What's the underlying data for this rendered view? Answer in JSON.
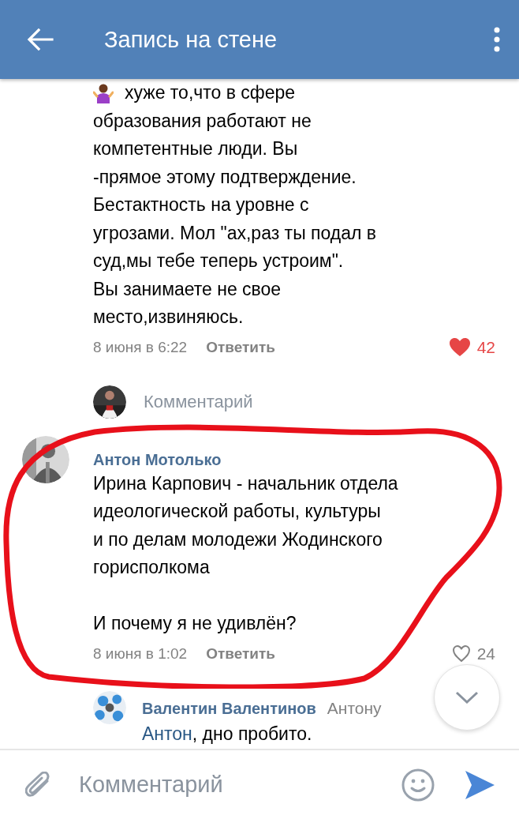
{
  "header": {
    "title": "Запись на стене"
  },
  "comments": [
    {
      "kind": "reply_tail",
      "text": "хуже то,что в сфере\nобразования работают не\nкомпетентные люди. Вы\n-прямое этому подтверждение.\nБестактность на уровне с\nугрозами. Мол \"ах,раз ты подал в\nсуд,мы тебе теперь устроим\".\nВы занимаете не свое\nместо,извиняюсь.",
      "date": "8 июня в 6:22",
      "reply_label": "Ответить",
      "likes": "42",
      "liked": true,
      "highlighted": false
    },
    {
      "kind": "reply_prompt",
      "placeholder": "Комментарий"
    },
    {
      "kind": "comment",
      "author": "Антон Мотолько",
      "text": "Ирина Карпович - начальник отдела\nидеологической работы, культуры\nи по делам молодежи Жодинского\nгорисполкома\n\nИ почему я не удивлён?",
      "date": "8 июня в 1:02",
      "reply_label": "Ответить",
      "likes": "24",
      "liked": false,
      "highlighted": true
    },
    {
      "kind": "reply",
      "author": "Валентин Валентинов",
      "reply_to": "Антону",
      "mention": "Антон",
      "text": ", дно пробито.",
      "highlighted": false
    }
  ],
  "composer": {
    "placeholder": "Комментарий"
  }
}
